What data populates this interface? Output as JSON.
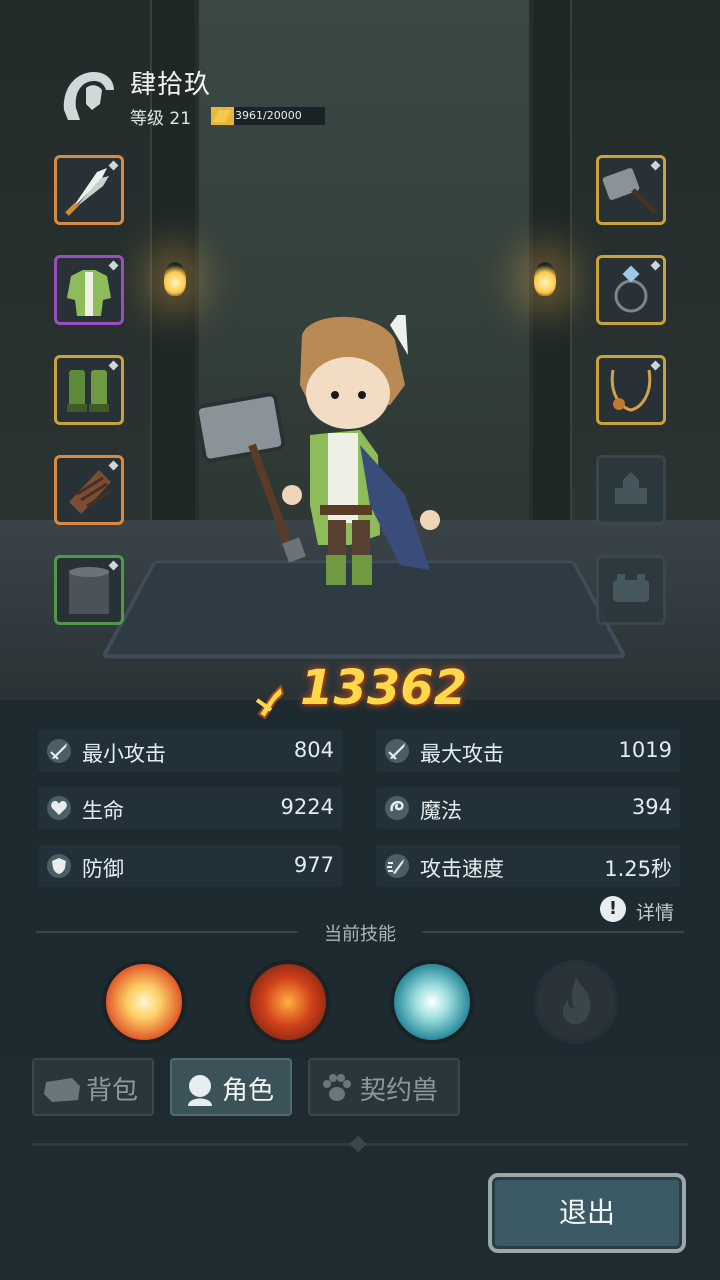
{
  "hero": {
    "name": "肆拾玖",
    "level_label": "等级 21",
    "xp_text": "3961/20000",
    "xp_fraction": 0.198
  },
  "equipment": {
    "left": [
      {
        "slot": "weapon-feather",
        "rarity": "orange"
      },
      {
        "slot": "armor",
        "rarity": "purple"
      },
      {
        "slot": "boots",
        "rarity": "gold"
      },
      {
        "slot": "bracer",
        "rarity": "orange"
      },
      {
        "slot": "pants",
        "rarity": "green"
      }
    ],
    "right": [
      {
        "slot": "hammer",
        "rarity": "gold"
      },
      {
        "slot": "ring",
        "rarity": "gold"
      },
      {
        "slot": "necklace",
        "rarity": "gold"
      },
      {
        "slot": "locked-1",
        "rarity": "locked"
      },
      {
        "slot": "locked-2",
        "rarity": "locked"
      }
    ]
  },
  "power": "13362",
  "stats": {
    "min_attack": {
      "label": "最小攻击",
      "value": "804"
    },
    "max_attack": {
      "label": "最大攻击",
      "value": "1019"
    },
    "hp": {
      "label": "生命",
      "value": "9224"
    },
    "magic": {
      "label": "魔法",
      "value": "394"
    },
    "defense": {
      "label": "防御",
      "value": "977"
    },
    "attack_speed": {
      "label": "攻击速度",
      "value": "1.25秒"
    }
  },
  "details_label": "详情",
  "skills_title": "当前技能",
  "tabs": {
    "bag": "背包",
    "character": "角色",
    "pet": "契约兽"
  },
  "exit_label": "退出",
  "colors": {
    "power": "#ffd84a",
    "xp": "#e7b73a",
    "rarity_orange": "#d88a42",
    "rarity_purple": "#9a4fc0",
    "rarity_gold": "#c9a23c",
    "rarity_green": "#4e9a4a"
  }
}
